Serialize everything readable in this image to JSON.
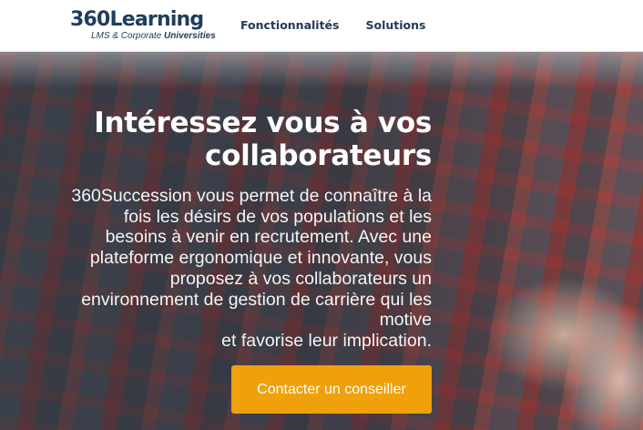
{
  "header": {
    "logo_text": "360Learning",
    "logo_sub_prefix": "LMS & Corporate ",
    "logo_sub_bold": "Universities",
    "nav": [
      {
        "label": "Fonctionnalités"
      },
      {
        "label": "Solutions"
      }
    ]
  },
  "hero": {
    "title_line1": "Intéressez vous à vos",
    "title_line2": "collaborateurs",
    "description_lines": [
      "360Succession vous permet de connaître à la",
      "fois les désirs de vos populations et les",
      "besoins à venir en recrutement. Avec une",
      "plateforme ergonomique et innovante, vous",
      "proposez à vos collaborateurs un",
      "environnement de gestion de carrière qui les",
      "motive",
      "et favorise leur implication."
    ],
    "cta_label": "Contacter un conseiller"
  },
  "colors": {
    "brand": "#1f3d5c",
    "cta": "#f0a00a",
    "nav_text": "#243a56"
  }
}
